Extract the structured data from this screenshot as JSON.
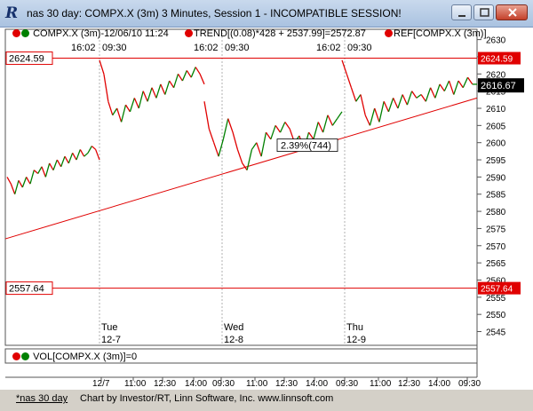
{
  "window": {
    "title": "nas 30 day: COMPX.X (3m) 3 Minutes, Session 1 - INCOMPATIBLE SESSION!",
    "logo": "R",
    "buttons": [
      "minimize-icon",
      "maximize-icon",
      "close-icon"
    ]
  },
  "legend": {
    "symbol": "COMPX.X (3m)-12/06/10 11:24",
    "trend": "TREND[(0.08)*428 + 2537.99]=2572.87",
    "ref": "REF[COMPX.X (3m)]"
  },
  "colors": {
    "up": "#008000",
    "down": "#e00000",
    "ref_line": "#e00000",
    "trend_line": "#e00000",
    "last_price_bg": "#000000"
  },
  "price_panel": {
    "top_time_labels": [
      "16:02",
      "09:30",
      "16:02",
      "09:30",
      "16:02",
      "09:30"
    ],
    "day_labels": [
      {
        "dow": "Tue",
        "date": "12-7"
      },
      {
        "dow": "Wed",
        "date": "12-8"
      },
      {
        "dow": "Thu",
        "date": "12-9"
      }
    ],
    "ref_levels": [
      {
        "value": 2624.59,
        "label": "2624.59"
      },
      {
        "value": 2557.64,
        "label": "2557.64"
      }
    ],
    "last_price": {
      "value": 2616.67,
      "label": "2616.67"
    },
    "annotation": "2.39%(744)",
    "y_ticks": [
      2545,
      2550,
      2555,
      2560,
      2565,
      2570,
      2575,
      2580,
      2585,
      2590,
      2595,
      2600,
      2605,
      2610,
      2615,
      2620,
      2625,
      2630
    ]
  },
  "volume_panel": {
    "label": "VOL[COMPX.X (3m)]=0"
  },
  "x_axis_labels": [
    "12/7",
    "11:00",
    "12:30",
    "14:00",
    "09:30",
    "11:00",
    "12:30",
    "14:00",
    "09:30",
    "11:00",
    "12:30",
    "14:00",
    "09:30"
  ],
  "footer": {
    "tab": "*nas 30 day",
    "credit": "Chart by Investor/RT, Linn Software, Inc. www.linnsoft.com"
  },
  "chart_data": {
    "type": "line",
    "ylim": [
      2541,
      2633
    ],
    "trendline": {
      "start": 2572,
      "end": 2613
    },
    "segments": [
      {
        "x_range": [
          8,
          112
        ],
        "points": [
          2590,
          2588,
          2585,
          2589,
          2587,
          2590,
          2588,
          2592,
          2591,
          2593,
          2590,
          2594,
          2592,
          2595,
          2593,
          2596,
          2594,
          2597,
          2595,
          2598,
          2596,
          2597,
          2599,
          2598,
          2595
        ]
      },
      {
        "x_range": [
          112,
          230
        ],
        "points": [
          2624,
          2620,
          2612,
          2608,
          2610,
          2606,
          2611,
          2609,
          2613,
          2610,
          2615,
          2612,
          2616,
          2613,
          2617,
          2614,
          2618,
          2616,
          2620,
          2618,
          2621,
          2619,
          2622,
          2620,
          2617
        ]
      },
      {
        "x_range": [
          230,
          385
        ],
        "points": [
          2612,
          2604,
          2600,
          2596,
          2601,
          2607,
          2603,
          2598,
          2594,
          2592,
          2598,
          2600,
          2596,
          2603,
          2601,
          2605,
          2603,
          2606,
          2604,
          2600,
          2602,
          2598,
          2603,
          2601,
          2606,
          2603,
          2608,
          2605,
          2607,
          2609
        ]
      },
      {
        "x_range": [
          385,
          537
        ],
        "points": [
          2624,
          2620,
          2616,
          2612,
          2614,
          2608,
          2605,
          2610,
          2606,
          2612,
          2609,
          2613,
          2610,
          2614,
          2611,
          2615,
          2613,
          2614,
          2612,
          2616,
          2613,
          2617,
          2615,
          2618,
          2614,
          2618,
          2616,
          2619,
          2617,
          2617
        ]
      }
    ]
  }
}
